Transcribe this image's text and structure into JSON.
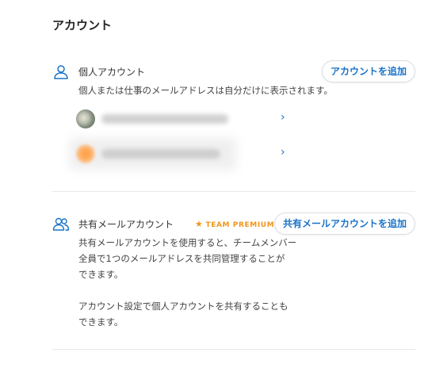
{
  "page": {
    "title": "アカウント"
  },
  "personal": {
    "title": "個人アカウント",
    "description": "個人または仕事のメールアドレスは自分だけに表示されます。",
    "add_button": "アカウントを追加",
    "accounts": [
      {
        "email": "",
        "avatar": "photo-avatar"
      },
      {
        "email": "",
        "avatar": "orange-avatar"
      }
    ]
  },
  "shared": {
    "title": "共有メールアカウント",
    "badge": "TEAM PREMIUM",
    "add_button": "共有メールアカウントを追加",
    "description_lines": [
      "共有メールアカウントを使用すると、チームメンバー",
      "全員で1つのメールアドレスを共同管理することが",
      "できます。"
    ],
    "note_lines": [
      "アカウント設定で個人アカウントを共有することも",
      "できます。"
    ]
  },
  "colors": {
    "accent": "#1a73c8",
    "badge": "#f0961e",
    "divider": "#e8e8e8"
  },
  "icons": {
    "personal": "person-icon",
    "shared": "people-icon",
    "chevron": "chevron-right-icon",
    "star": "star-icon"
  }
}
